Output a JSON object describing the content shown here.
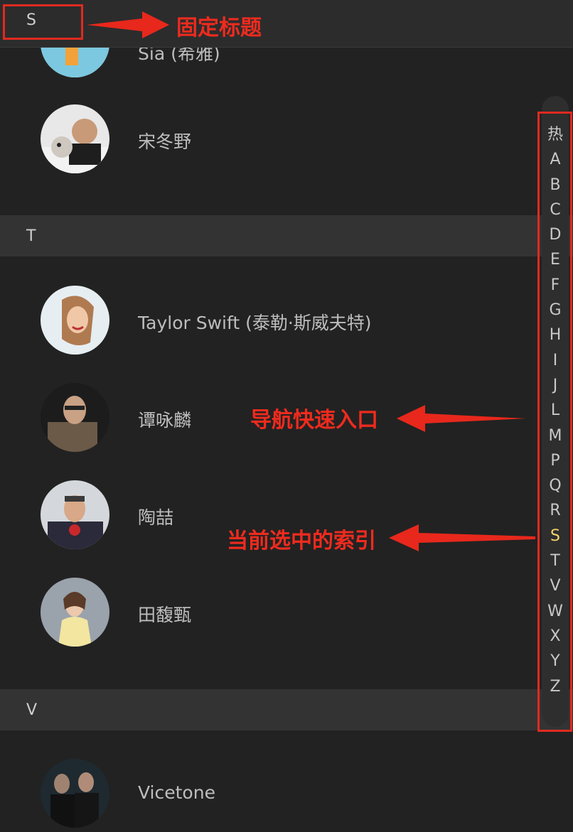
{
  "sticky_header": {
    "letter": "S"
  },
  "sections": [
    {
      "letter": "T"
    },
    {
      "letter": "V"
    }
  ],
  "rows": [
    {
      "name": "Sia (希雅)",
      "avatar": "sia-avatar"
    },
    {
      "name": "宋冬野",
      "avatar": "song-dongye-avatar"
    },
    {
      "name": "Taylor Swift (泰勒·斯威夫特)",
      "avatar": "taylor-swift-avatar"
    },
    {
      "name": "谭咏麟",
      "avatar": "tan-yonglin-avatar"
    },
    {
      "name": "陶喆",
      "avatar": "tao-zhe-avatar"
    },
    {
      "name": "田馥甄",
      "avatar": "tian-fuzhen-avatar"
    },
    {
      "name": "Vicetone",
      "avatar": "vicetone-avatar"
    }
  ],
  "index_bar": {
    "items": [
      "热",
      "A",
      "B",
      "C",
      "D",
      "E",
      "F",
      "G",
      "H",
      "I",
      "J",
      "L",
      "M",
      "P",
      "Q",
      "R",
      "S",
      "T",
      "V",
      "W",
      "X",
      "Y",
      "Z"
    ],
    "active": "S"
  },
  "annotations": {
    "sticky_title": "固定标题",
    "nav_entry": "导航快速入口",
    "current_index": "当前选中的索引"
  },
  "colors": {
    "background": "#222222",
    "section_header": "#333333",
    "active_index": "#f7d36a",
    "annotation": "#ee2b1e"
  }
}
